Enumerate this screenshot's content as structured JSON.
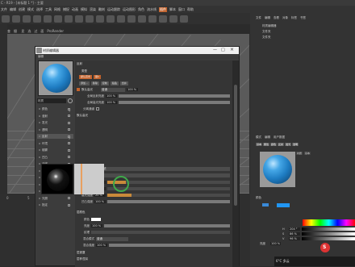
{
  "app": {
    "title": "C - R19 - [未标题 1 *] - 主要"
  },
  "menubar": {
    "items": [
      "文件",
      "编辑",
      "创建",
      "模式",
      "选择",
      "工具",
      "网格",
      "捕捉",
      "动画",
      "模拟",
      "渲染",
      "雕刻",
      "运动跟踪",
      "运动图形",
      "角色",
      "流水线",
      "插件",
      "脚本",
      "窗口",
      "帮助"
    ]
  },
  "viewport": {
    "menu": [
      "查看",
      "摄像机",
      "显示",
      "选项",
      "过滤",
      "面板",
      "ProRender"
    ]
  },
  "timeline": {
    "ticks": [
      "0",
      "5",
      "10",
      "15",
      "20",
      "25",
      "30"
    ]
  },
  "object_manager": {
    "tabs": [
      "文件",
      "编辑",
      "查看",
      "对象",
      "标签",
      "书签"
    ],
    "rows": [
      "材质编辑器",
      "文件夹",
      "文件夹"
    ]
  },
  "attr_manager": {
    "tabs": [
      "模式",
      "编辑",
      "用户数据"
    ],
    "subtabs": [
      "基本",
      "属性",
      "颜色",
      "反射",
      "发光",
      "透明"
    ],
    "side_buttons": [
      "材质",
      "基本"
    ],
    "section": "颜色"
  },
  "color_panel": {
    "swatch": "#2196f3",
    "rows": [
      {
        "label": "H",
        "value": "204 °"
      },
      {
        "label": "S",
        "value": "86 %"
      },
      {
        "label": "V",
        "value": "96 %"
      }
    ],
    "brightness_label": "亮度",
    "brightness": "100 %"
  },
  "editor": {
    "title": "材质编辑器",
    "menu": "编辑",
    "material_name": "材质",
    "channels": [
      {
        "label": "颜色",
        "checked": true
      },
      {
        "label": "漫射",
        "checked": false
      },
      {
        "label": "发光",
        "checked": false
      },
      {
        "label": "透明",
        "checked": false
      },
      {
        "label": "反射",
        "checked": true
      },
      {
        "label": "环境",
        "checked": false
      },
      {
        "label": "烟雾",
        "checked": false
      },
      {
        "label": "凹凸",
        "checked": false
      },
      {
        "label": "法线",
        "checked": false
      },
      {
        "label": "Alpha",
        "checked": false
      },
      {
        "label": "辉光",
        "checked": false
      },
      {
        "label": "置换",
        "checked": false
      },
      {
        "label": "编辑",
        "checked": false
      },
      {
        "label": "光照",
        "checked": false
      },
      {
        "label": "指定",
        "checked": false
      }
    ],
    "reflect_header": "反射",
    "type_label": "类型",
    "layer_buttons": [
      "默认高光",
      "层1"
    ],
    "ops": [
      "添加...",
      "移除",
      "复制",
      "粘贴",
      "合并"
    ],
    "layer_row": {
      "name": "默认高光",
      "mode": "普通",
      "value": "100 %"
    },
    "global_reflect": {
      "label": "全局反射亮度",
      "value": "100 %"
    },
    "global_spec": {
      "label": "全局高光亮度",
      "value": "100 %"
    },
    "sep_pass": "分离通道",
    "default_section": "默认高光",
    "type_row": {
      "label": "类型",
      "value": "高光 - 传统"
    },
    "atten_row": {
      "label": "衰减",
      "value": "添加"
    },
    "params": [
      {
        "label": "粗糙度",
        "value": "15 %",
        "fill": 0.15
      },
      {
        "label": "反射强度",
        "value": "0 %",
        "fill": 0.0
      },
      {
        "label": "高光强度",
        "value": "20 %",
        "fill": 0.2
      },
      {
        "label": "凹凸强度",
        "value": "100 %",
        "fill": 1.0
      }
    ],
    "layer_color_section": "层颜色",
    "color_label": "颜色",
    "brightness_label": "亮度",
    "brightness": "100 %",
    "texture_label": "纹理",
    "mix_mode_label": "混合模式",
    "mix_mode": "普通",
    "mix_strength_label": "混合强度",
    "mix_strength": "100 %",
    "mask_section": "层遮罩",
    "fresnel_section": "层菲涅耳"
  },
  "taskbar": {
    "weather": "6°C 多云",
    "ime": "S"
  }
}
